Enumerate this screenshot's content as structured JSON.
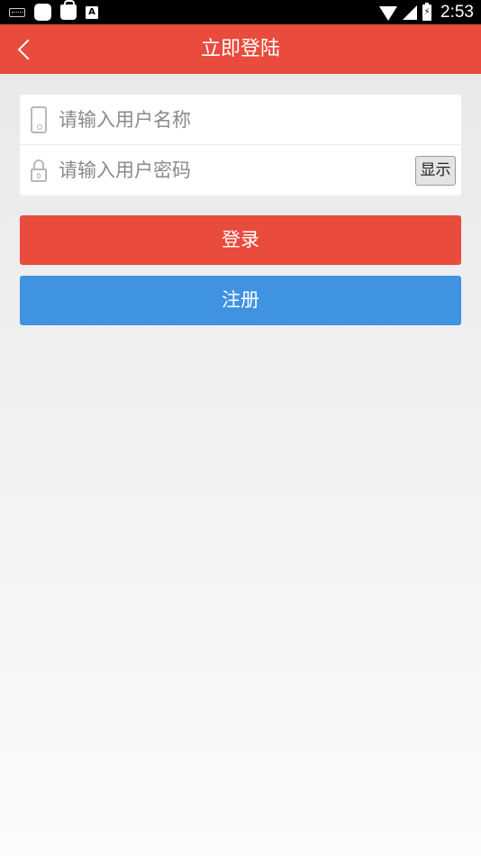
{
  "status_bar": {
    "time": "2:53",
    "icons": [
      "keyboard-icon",
      "app-icon",
      "bag-icon",
      "a-icon",
      "wifi-icon",
      "signal-icon",
      "battery-charging-icon"
    ]
  },
  "nav": {
    "title": "立即登陆",
    "back_icon": "chevron-left-icon",
    "background": "#e94b3c"
  },
  "form": {
    "username": {
      "placeholder": "请输入用户名称",
      "value": "",
      "icon": "phone-icon"
    },
    "password": {
      "placeholder": "请输入用户密码",
      "value": "",
      "icon": "lock-icon",
      "toggle_label": "显示"
    }
  },
  "buttons": {
    "login": {
      "label": "登录",
      "color": "#e94b3c"
    },
    "register": {
      "label": "注册",
      "color": "#3f93e1"
    }
  }
}
